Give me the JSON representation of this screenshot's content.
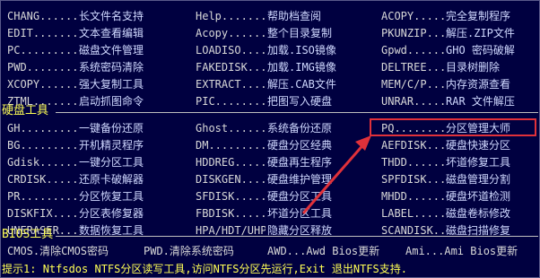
{
  "top_grid": [
    [
      [
        "CHANG.",
        "长文件名支持"
      ],
      [
        "Help.",
        "帮助档查阅"
      ],
      [
        "ACOPY.",
        "完全复制程序"
      ]
    ],
    [
      [
        "EDIT.",
        "文本查看编辑"
      ],
      [
        "Acopy.",
        "整个目录复制"
      ],
      [
        "PKUNZIP.",
        "解压.ZIP文件"
      ]
    ],
    [
      [
        "PC.",
        "磁盘文件管理"
      ],
      [
        "LOADISO.",
        "加载.ISO镜像"
      ],
      [
        "Gpwd.",
        "GHO 密码破解"
      ]
    ],
    [
      [
        "PWD.",
        "系统密码清除"
      ],
      [
        "FAKEDISK.",
        "加载.IMG镜像"
      ],
      [
        "DELTREE.",
        "目录树删除"
      ]
    ],
    [
      [
        "XCOPY.",
        "强大复制工具"
      ],
      [
        "EXTRACT.",
        "解压.CAB文件"
      ],
      [
        "MEM/C/P.",
        "内存资源查看"
      ]
    ],
    [
      [
        "ZTML.",
        "启动抓图命令"
      ],
      [
        "PIC.",
        "把图写入硬盘"
      ],
      [
        "UNRAR.",
        "RAR 文件解压"
      ]
    ]
  ],
  "disk_section_title": "硬盘工具",
  "disk_grid": [
    [
      [
        "GH.",
        "一键备份还原"
      ],
      [
        "Ghost.",
        "系统备份还原"
      ],
      [
        "PQ.",
        "分区管理大师"
      ]
    ],
    [
      [
        "BG.",
        "开机精灵程序"
      ],
      [
        "DM.",
        "硬盘分区经典"
      ],
      [
        "AEFDISK.",
        "硬盘快速分区"
      ]
    ],
    [
      [
        "Gdisk.",
        "一键分区工具"
      ],
      [
        "HDDREG.",
        "硬盘再生程序"
      ],
      [
        "THDD.",
        "坏道修复工具"
      ]
    ],
    [
      [
        "CRDISK.",
        "还原卡破解器"
      ],
      [
        "DISKGEN.",
        "硬盘维护管理"
      ],
      [
        "SPFDISK.",
        "磁盘管理分割"
      ]
    ],
    [
      [
        "PR.",
        "分区恢复工具"
      ],
      [
        "SFDISK.",
        "硬盘分区工具"
      ],
      [
        "MHDD.",
        "硬盘坏道检测"
      ]
    ],
    [
      [
        "DISKFIX.",
        "分区表修复器"
      ],
      [
        "FBDISK.",
        "坏道分区工具"
      ],
      [
        "LABEL.",
        "磁盘卷标修改"
      ]
    ],
    [
      [
        "UNERASER.",
        "数据恢复工具"
      ],
      [
        "HPA/HDT/UHPA/LEos",
        "隐藏分区释放"
      ],
      [
        "SCANDISK.",
        "磁盘扫描修复"
      ]
    ]
  ],
  "bios_section_title": "BIOS工具",
  "bios_items": [
    "CMOS.清除CMOS密码",
    "PWD.清除系统密码",
    "AWD...Awd Bios更新",
    "Ami...Ami Bios更新"
  ],
  "hint": {
    "label": "提示1:",
    "text": "Ntfsdos  NTFS分区读写工具,访问NTFS分区先运行,Exit 退出NTFS支持."
  },
  "annotation_color": "#e0313a"
}
